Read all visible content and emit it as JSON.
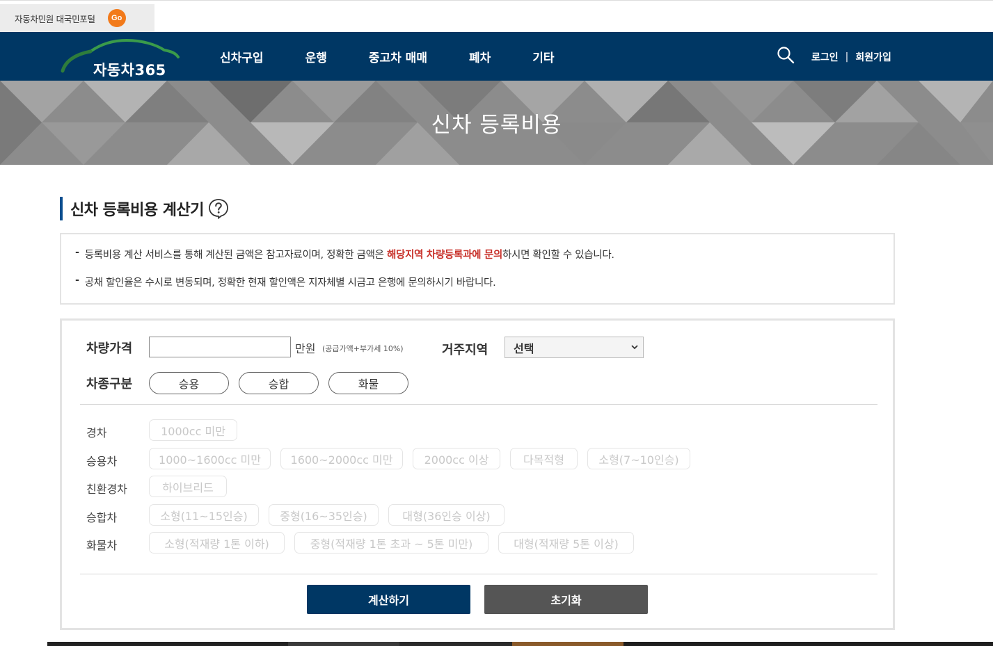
{
  "portal": {
    "text": "자동차민원 대국민포털",
    "go_label": "Go"
  },
  "nav": {
    "logo_text": "자동차365",
    "menu": [
      "신차구입",
      "운행",
      "중고차 매매",
      "폐차",
      "기타"
    ],
    "login": "로그인",
    "separator": "|",
    "signup": "회원가입"
  },
  "banner": {
    "title": "신차 등록비용"
  },
  "section": {
    "title": "신차 등록비용 계산기"
  },
  "notice": {
    "line1_prefix": "등록비용 계산 서비스를 통해 계산된 금액은 참고자료이며, 정확한 금액은 ",
    "line1_highlight": "해당지역 차량등록과에 문의",
    "line1_suffix": "하시면 확인할 수 있습니다.",
    "line2": "공채 할인율은 수시로 변동되며, 정확한 현재 할인액은 지자체별 시금고 은행에 문의하시기 바랍니다."
  },
  "form": {
    "price_label": "차량가격",
    "price_value": "",
    "price_unit": "만원",
    "price_note": "(공급가액+부가세 10%)",
    "region_label": "거주지역",
    "region_selected": "선택",
    "type_label": "차종구분",
    "type_options": [
      "승용",
      "승합",
      "화물"
    ]
  },
  "categories": [
    {
      "label": "경차",
      "options": [
        "1000cc 미만"
      ]
    },
    {
      "label": "승용차",
      "options": [
        "1000~1600cc 미만",
        "1600~2000cc 미만",
        "2000cc 이상",
        "다목적형",
        "소형(7~10인승)"
      ]
    },
    {
      "label": "친환경차",
      "options": [
        "하이브리드"
      ]
    },
    {
      "label": "승합차",
      "options": [
        "소형(11~15인승)",
        "중형(16~35인승)",
        "대형(36인승 이상)"
      ]
    },
    {
      "label": "화물차",
      "options": [
        "소형(적재량 1톤 이하)",
        "중형(적재량 1톤 초과 ~ 5톤 미만)",
        "대형(적재량 5톤 이상)"
      ]
    }
  ],
  "buttons": {
    "calculate": "계산하기",
    "reset": "초기화"
  },
  "colors": {
    "nav_bg": "#003764",
    "accent_border": "#0a4e8f",
    "highlight": "#c8312a",
    "go": "#f27a1a",
    "reset_bg": "#555555"
  }
}
